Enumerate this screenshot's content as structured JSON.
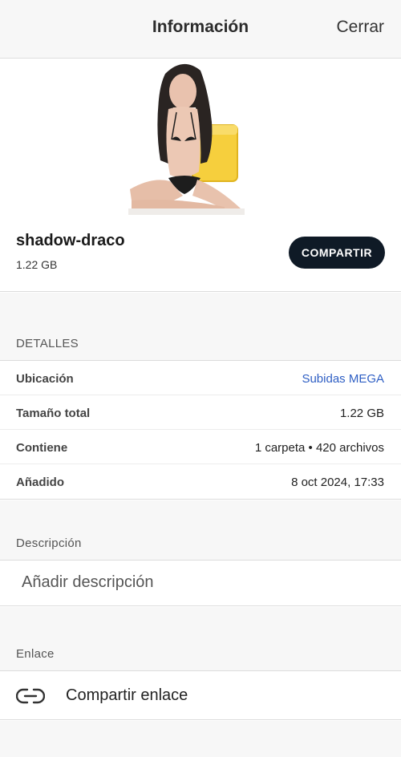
{
  "header": {
    "title": "Información",
    "close_label": "Cerrar"
  },
  "item": {
    "name": "shadow-draco",
    "size": "1.22 GB",
    "share_label": "COMPARTIR"
  },
  "details": {
    "heading": "DETALLES",
    "rows": [
      {
        "key": "Ubicación",
        "value": "Subidas MEGA"
      },
      {
        "key": "Tamaño total",
        "value": "1.22 GB"
      },
      {
        "key": "Contiene",
        "value": "1 carpeta • 420 archivos"
      },
      {
        "key": "Añadido",
        "value": "8 oct 2024, 17:33"
      }
    ]
  },
  "description": {
    "heading": "Descripción",
    "placeholder": "Añadir descripción"
  },
  "link": {
    "heading": "Enlace",
    "label": "Compartir enlace",
    "icon": "link-icon"
  },
  "colors": {
    "accent_link": "#2f5fc4",
    "button_bg": "#0f1a26",
    "folder_yellow": "#f6cf3d"
  }
}
